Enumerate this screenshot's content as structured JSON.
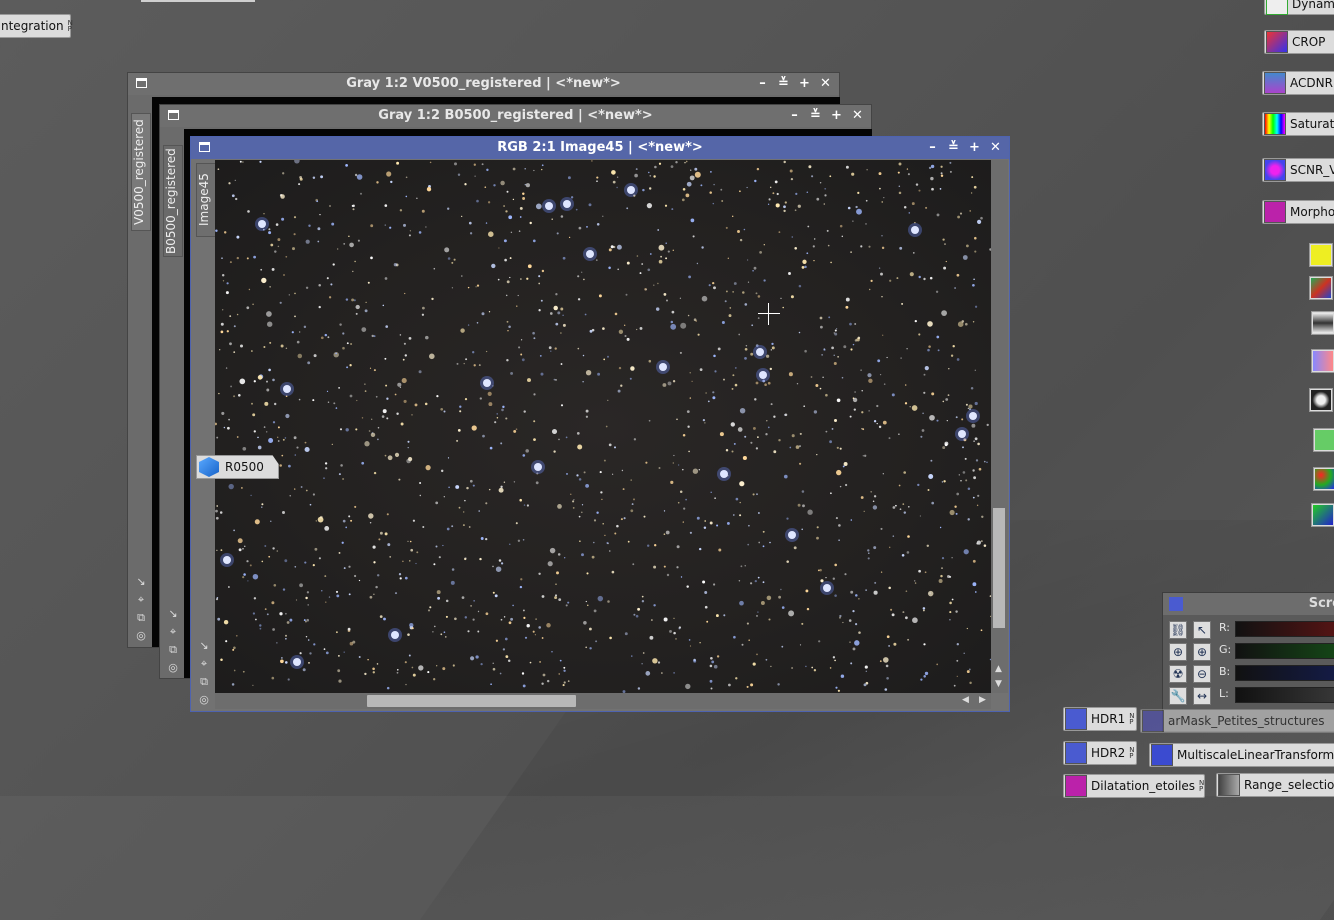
{
  "desktop": {
    "icons": [
      {
        "id": "integration",
        "label": "ntegration"
      },
      {
        "id": "dynamic",
        "label": "Dynam"
      },
      {
        "id": "crop",
        "label": "CROP"
      },
      {
        "id": "acdnr",
        "label": "ACDNR"
      },
      {
        "id": "saturation",
        "label": "Saturat"
      },
      {
        "id": "scnr",
        "label": "SCNR_V"
      },
      {
        "id": "morphology",
        "label": "Morphol"
      },
      {
        "id": "hdr1",
        "label": "HDR1"
      },
      {
        "id": "hdr2",
        "label": "HDR2"
      },
      {
        "id": "starmask",
        "label": "arMask_Petites_structures"
      },
      {
        "id": "mlt",
        "label": "MultiscaleLinearTransform_"
      },
      {
        "id": "dilatation",
        "label": "Dilatation_etoiles"
      },
      {
        "id": "range",
        "label": "Range_selectio"
      }
    ]
  },
  "windows": [
    {
      "title": "Gray 1:2 V0500_registered | <*new*>",
      "tab": "V0500_registered"
    },
    {
      "title": "Gray 1:2 B0500_registered | <*new*>",
      "tab": "B0500_registered"
    },
    {
      "title": "RGB 2:1 Image45 | <*new*>",
      "tab": "Image45"
    }
  ],
  "window_controls": {
    "minimize": "–",
    "shade": "≚",
    "maximize": "+",
    "close": "✕"
  },
  "preview": {
    "label": "R0500"
  },
  "stf_panel": {
    "title": "Scre",
    "channels": [
      {
        "label": "R:",
        "color": "#5a1414"
      },
      {
        "label": "G:",
        "color": "#154a17"
      },
      {
        "label": "B:",
        "color": "#141c4a"
      },
      {
        "label": "L:",
        "color": "#3a3a3a"
      }
    ]
  },
  "colors": {
    "active_title": "#5566a8",
    "inactive_title": "#6f6f6f"
  }
}
